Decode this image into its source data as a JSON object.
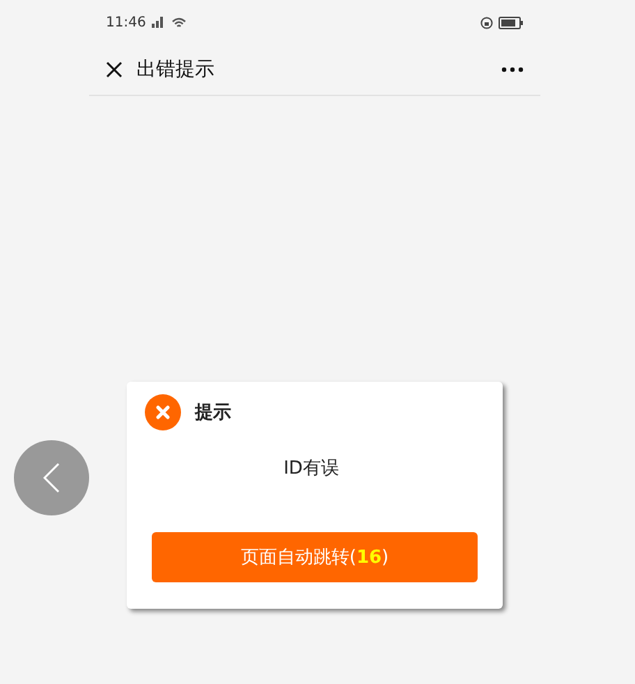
{
  "status_bar": {
    "time": "11:46"
  },
  "nav_bar": {
    "title": "出错提示"
  },
  "dialog": {
    "title": "提示",
    "message": "ID有误",
    "button": "页面自动跳转(**16**)"
  }
}
